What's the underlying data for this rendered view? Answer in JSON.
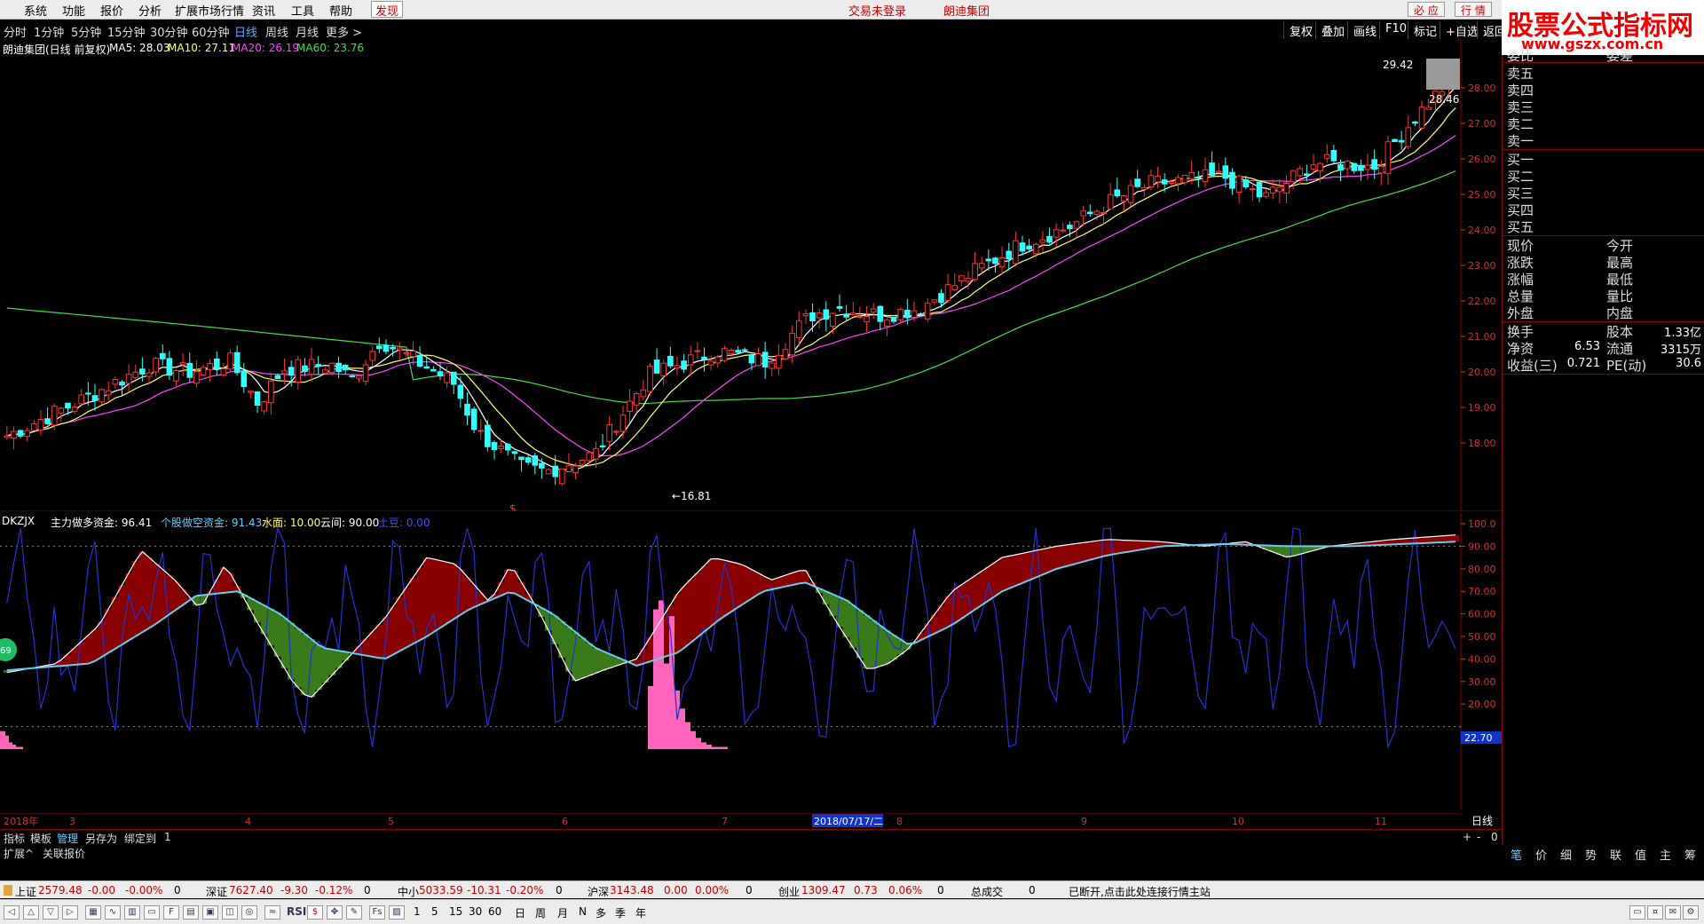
{
  "menu": {
    "items": [
      "系统",
      "功能",
      "报价",
      "分析",
      "扩展市场行情",
      "资讯",
      "工具",
      "帮助"
    ],
    "discover": "发现",
    "center": [
      "交易未登录",
      "朗迪集团"
    ],
    "right_buttons": [
      "必 应",
      "行 情"
    ]
  },
  "periods": {
    "items": [
      "分时",
      "1分钟",
      "5分钟",
      "15分钟",
      "30分钟",
      "60分钟",
      "日线",
      "周线",
      "月线",
      "更多 >"
    ],
    "active": "日线"
  },
  "toolbar": [
    "复权",
    "叠加",
    "画线",
    "F10",
    "标记",
    "+自选",
    "返回"
  ],
  "main_chart": {
    "title": "朗迪集团(日线 前复权)",
    "ma": [
      {
        "label": "MA5: 28.03",
        "color": "#ffffff"
      },
      {
        "label": "MA10: 27.11",
        "color": "#ffff66"
      },
      {
        "label": "MA20: 26.19",
        "color": "#ff44ff"
      },
      {
        "label": "MA60: 23.76",
        "color": "#44dd44"
      }
    ],
    "y_ticks": [
      "28.00",
      "27.00",
      "26.00",
      "25.00",
      "24.00",
      "23.00",
      "22.00",
      "21.00",
      "20.00",
      "19.00",
      "18.00"
    ],
    "high_label": "29.42",
    "last_label": "28.46",
    "low_label": "←16.81",
    "marker": "$"
  },
  "sub_chart": {
    "name": "DKZJX",
    "labels": [
      {
        "text": "主力做多资金: 96.41",
        "color": "#ffffff"
      },
      {
        "text": "个股做空资金: 91.43",
        "color": "#66ccff"
      },
      {
        "text": "水面: 10.00",
        "color": "#ffff66"
      },
      {
        "text": "云间: 90.00",
        "color": "#ffffff"
      },
      {
        "text": "土豆: 0.00",
        "color": "#3355ff"
      }
    ],
    "y_ticks": [
      "100.0",
      "90.00",
      "80.00",
      "70.00",
      "60.00",
      "50.00",
      "40.00",
      "30.00",
      "20.00"
    ],
    "cursor_value": "22.70",
    "badge": "69"
  },
  "x_axis": {
    "labels": [
      "2018年",
      "3",
      "4",
      "5",
      "6",
      "7",
      "8",
      "9",
      "10",
      "11"
    ],
    "cursor": "2018/07/17/二",
    "right": "日线"
  },
  "right_panel": {
    "logo_title": "股票公式指标网",
    "logo_url": "www.gszx.com.cn",
    "top": [
      "委比",
      "委差"
    ],
    "sell": [
      "卖五",
      "卖四",
      "卖三",
      "卖二",
      "卖一"
    ],
    "buy": [
      "买一",
      "买二",
      "买三",
      "买四",
      "买五"
    ],
    "quote_left": [
      "现价",
      "涨跌",
      "涨幅",
      "总量",
      "外盘"
    ],
    "quote_right": [
      "今开",
      "最高",
      "最低",
      "量比",
      "内盘"
    ],
    "stats": [
      {
        "l": "换手",
        "v": "",
        "l2": "股本",
        "v2": "1.33亿"
      },
      {
        "l": "净资",
        "v": "6.53",
        "l2": "流通",
        "v2": "3315万"
      },
      {
        "l": "收益(三)",
        "v": "0.721",
        "l2": "PE(动)",
        "v2": "30.6"
      }
    ],
    "tabs": [
      "笔",
      "价",
      "细",
      "势",
      "联",
      "值",
      "主",
      "筹"
    ]
  },
  "bottom_tabs": [
    "指标",
    "模板",
    "管理",
    "另存为",
    "绑定到",
    "1"
  ],
  "bottom_tabs_active": "管理",
  "bottom_tabs2": [
    "扩展^",
    "关联报价"
  ],
  "zoom_controls": [
    "+",
    "-",
    "0"
  ],
  "status": [
    {
      "name": "上证",
      "v": "2579.48",
      "c": "-0.00",
      "p": "-0.00%",
      "n": "0"
    },
    {
      "name": "深证",
      "v": "7627.40",
      "c": "-9.30",
      "p": "-0.12%",
      "n": "0"
    },
    {
      "name": "中小",
      "v": "5033.59",
      "c": "-10.31",
      "p": "-0.20%",
      "n": "0"
    },
    {
      "name": "沪深",
      "v": "3143.48",
      "c": "0.00",
      "p": "0.00%",
      "n": "0"
    },
    {
      "name": "创业",
      "v": "1309.47",
      "c": "0.73",
      "p": "0.06%",
      "n": "0"
    }
  ],
  "status_total": "总成交",
  "status_total_v": "0",
  "status_msg": "已断开,点击此处连接行情主站",
  "bottom_toolbar": [
    "RSI",
    "1",
    "5",
    "15",
    "30",
    "60",
    "日",
    "周",
    "月",
    "N",
    "多",
    "季",
    "年"
  ]
}
